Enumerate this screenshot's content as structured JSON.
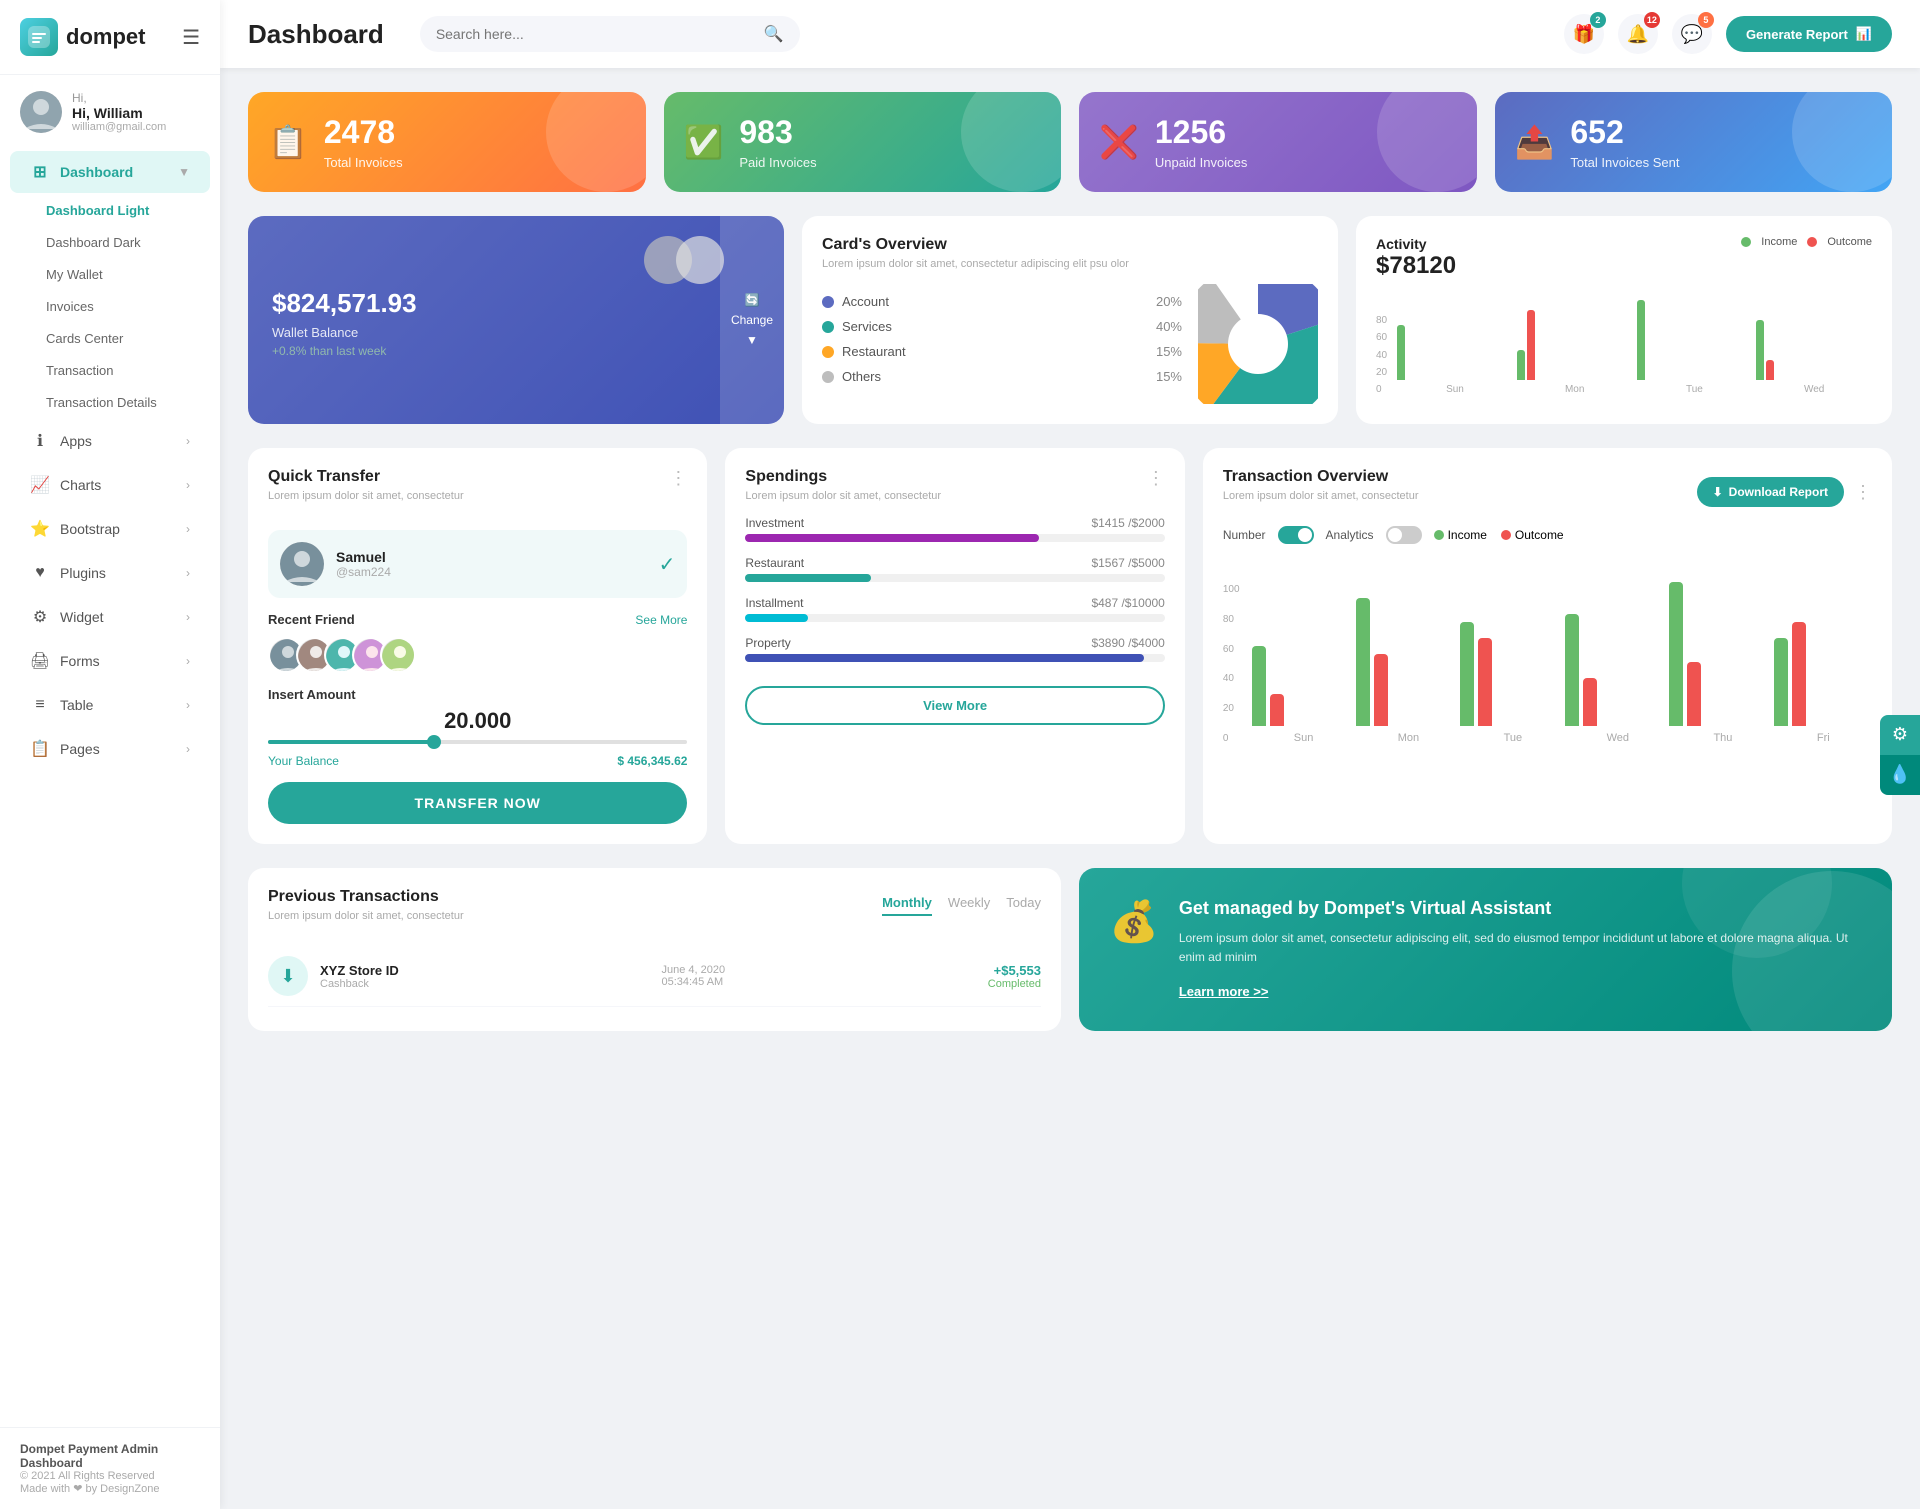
{
  "app": {
    "name": "dompet",
    "logo_emoji": "👛"
  },
  "header": {
    "title": "Dashboard",
    "search_placeholder": "Search here...",
    "generate_btn": "Generate Report",
    "notifications": [
      {
        "icon": "🎁",
        "badge": "2",
        "badge_color": "teal"
      },
      {
        "icon": "🔔",
        "badge": "12",
        "badge_color": "red"
      },
      {
        "icon": "💬",
        "badge": "5",
        "badge_color": "orange"
      }
    ]
  },
  "user": {
    "greeting": "Hi, William",
    "email": "william@gmail.com"
  },
  "sidebar": {
    "nav_items": [
      {
        "label": "Dashboard",
        "icon": "⊞",
        "active": true,
        "has_arrow": true
      },
      {
        "label": "Apps",
        "icon": "ℹ",
        "active": false,
        "has_arrow": true
      },
      {
        "label": "Charts",
        "icon": "📈",
        "active": false,
        "has_arrow": true
      },
      {
        "label": "Bootstrap",
        "icon": "⭐",
        "active": false,
        "has_arrow": true
      },
      {
        "label": "Plugins",
        "icon": "❤",
        "active": false,
        "has_arrow": true
      },
      {
        "label": "Widget",
        "icon": "⚙",
        "active": false,
        "has_arrow": true
      },
      {
        "label": "Forms",
        "icon": "🖨",
        "active": false,
        "has_arrow": true
      },
      {
        "label": "Table",
        "icon": "≡",
        "active": false,
        "has_arrow": true
      },
      {
        "label": "Pages",
        "icon": "📋",
        "active": false,
        "has_arrow": true
      }
    ],
    "sub_items": [
      {
        "label": "Dashboard Light",
        "active": true
      },
      {
        "label": "Dashboard Dark",
        "active": false
      },
      {
        "label": "My Wallet",
        "active": false
      },
      {
        "label": "Invoices",
        "active": false
      },
      {
        "label": "Cards Center",
        "active": false
      },
      {
        "label": "Transaction",
        "active": false
      },
      {
        "label": "Transaction Details",
        "active": false
      }
    ],
    "footer": {
      "brand": "Dompet Payment Admin Dashboard",
      "copyright": "© 2021 All Rights Reserved",
      "made_with": "Made with ❤ by DesignZone"
    }
  },
  "stat_cards": [
    {
      "number": "2478",
      "label": "Total Invoices",
      "icon": "📋",
      "color": "orange"
    },
    {
      "number": "983",
      "label": "Paid Invoices",
      "icon": "✅",
      "color": "green"
    },
    {
      "number": "1256",
      "label": "Unpaid Invoices",
      "icon": "❌",
      "color": "purple"
    },
    {
      "number": "652",
      "label": "Total Invoices Sent",
      "icon": "📤",
      "color": "teal"
    }
  ],
  "wallet": {
    "amount": "$824,571.93",
    "label": "Wallet Balance",
    "change": "+0.8% than last week",
    "change_btn": "Change"
  },
  "cards_overview": {
    "title": "Card's Overview",
    "subtitle": "Lorem ipsum dolor sit amet, consectetur adipiscing elit psu olor",
    "legend": [
      {
        "name": "Account",
        "pct": "20%",
        "color": "#5c6bc0"
      },
      {
        "name": "Services",
        "pct": "40%",
        "color": "#26a69a"
      },
      {
        "name": "Restaurant",
        "pct": "15%",
        "color": "#ffa726"
      },
      {
        "name": "Others",
        "pct": "15%",
        "color": "#bdbdbd"
      }
    ],
    "pie": {
      "segments": [
        {
          "label": "Account",
          "pct": 20,
          "color": "#5c6bc0"
        },
        {
          "label": "Services",
          "pct": 40,
          "color": "#26a69a"
        },
        {
          "label": "Restaurant",
          "pct": 15,
          "color": "#ffa726"
        },
        {
          "label": "Others",
          "pct": 15,
          "color": "#bdbdbd"
        }
      ]
    }
  },
  "activity": {
    "title": "Activity",
    "amount": "$78120",
    "legend": [
      {
        "name": "Income",
        "color": "#66bb6a"
      },
      {
        "name": "Outcome",
        "color": "#ef5350"
      }
    ],
    "bars": [
      {
        "label": "Sun",
        "income": 55,
        "outcome": 0
      },
      {
        "label": "Mon",
        "income": 30,
        "outcome": 70
      },
      {
        "label": "Tue",
        "income": 80,
        "outcome": 0
      },
      {
        "label": "Wed",
        "income": 60,
        "outcome": 20
      }
    ],
    "y_axis": [
      "80",
      "60",
      "40",
      "20",
      "0"
    ]
  },
  "quick_transfer": {
    "title": "Quick Transfer",
    "subtitle": "Lorem ipsum dolor sit amet, consectetur",
    "contact": {
      "name": "Samuel",
      "handle": "@sam224"
    },
    "recent_friend_label": "Recent Friend",
    "see_more": "See More",
    "amount_label": "Insert Amount",
    "amount": "20.000",
    "balance_label": "Your Balance",
    "balance": "$ 456,345.62",
    "transfer_btn": "TRANSFER NOW"
  },
  "spendings": {
    "title": "Spendings",
    "subtitle": "Lorem ipsum dolor sit amet, consectetur",
    "items": [
      {
        "name": "Investment",
        "current": "$1415",
        "max": "$2000",
        "pct": 70,
        "color": "#9c27b0"
      },
      {
        "name": "Restaurant",
        "current": "$1567",
        "max": "$5000",
        "pct": 30,
        "color": "#26a69a"
      },
      {
        "name": "Installment",
        "current": "$487",
        "max": "$10000",
        "pct": 15,
        "color": "#00bcd4"
      },
      {
        "name": "Property",
        "current": "$3890",
        "max": "$4000",
        "pct": 95,
        "color": "#3f51b5"
      }
    ],
    "view_more_btn": "View More"
  },
  "transaction_overview": {
    "title": "Transaction Overview",
    "subtitle": "Lorem ipsum dolor sit amet, consectetur",
    "download_btn": "Download Report",
    "toggles": [
      {
        "label": "Number",
        "state": "on"
      },
      {
        "label": "Analytics",
        "state": "off"
      }
    ],
    "legend": [
      {
        "name": "Income",
        "color": "#66bb6a"
      },
      {
        "name": "Outcome",
        "color": "#ef5350"
      }
    ],
    "bars": [
      {
        "label": "Sun",
        "income": 50,
        "outcome": 20
      },
      {
        "label": "Mon",
        "income": 80,
        "outcome": 45
      },
      {
        "label": "Tue",
        "income": 65,
        "outcome": 55
      },
      {
        "label": "Wed",
        "income": 70,
        "outcome": 30
      },
      {
        "label": "Thu",
        "income": 90,
        "outcome": 40
      },
      {
        "label": "Fri",
        "income": 55,
        "outcome": 65
      }
    ],
    "y_axis": [
      "100",
      "80",
      "60",
      "40",
      "20",
      "0"
    ]
  },
  "previous_transactions": {
    "title": "Previous Transactions",
    "subtitle": "Lorem ipsum dolor sit amet, consectetur",
    "tabs": [
      "Monthly",
      "Weekly",
      "Today"
    ],
    "active_tab": "Monthly",
    "rows": [
      {
        "name": "XYZ Store ID",
        "type": "Cashback",
        "date": "June 4, 2020",
        "time": "05:34:45 AM",
        "amount": "+$5,553",
        "status": "Completed",
        "icon": "⬇"
      }
    ]
  },
  "virtual_assistant": {
    "title": "Get managed by Dompet's Virtual Assistant",
    "description": "Lorem ipsum dolor sit amet, consectetur adipiscing elit, sed do eiusmod tempor incididunt ut labore et dolore magna aliqua. Ut enim ad minim",
    "link": "Learn more >>"
  }
}
